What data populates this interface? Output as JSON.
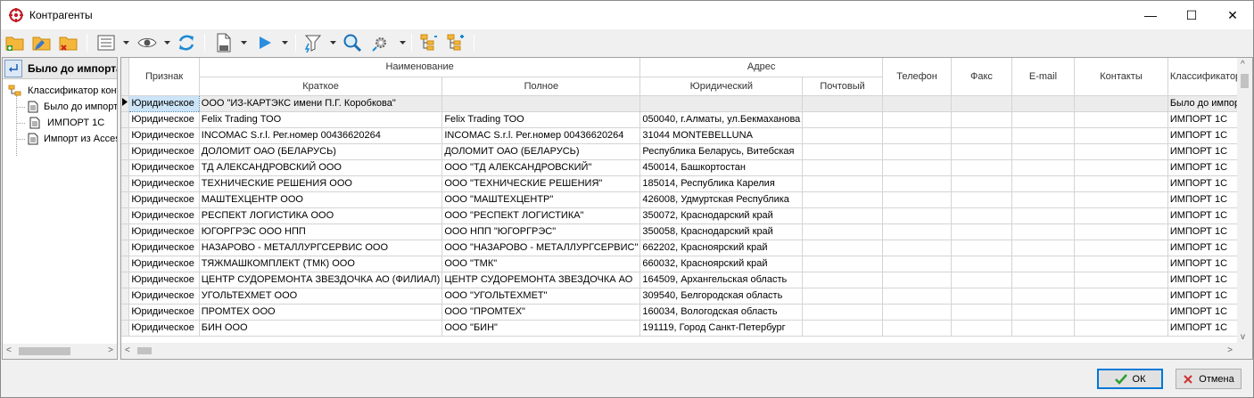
{
  "window": {
    "title": "Контрагенты",
    "minimize_glyph": "—",
    "maximize_glyph": "☐",
    "close_glyph": "✕"
  },
  "toolbar": {
    "icons": [
      "folder-add-icon",
      "folder-edit-icon",
      "folder-delete-icon",
      "list-view-icon",
      "eye-icon",
      "refresh-icon",
      "document-icon",
      "play-icon",
      "filter-icon",
      "search-icon",
      "settings-icon",
      "tree-collapse-icon",
      "tree-expand-icon"
    ]
  },
  "left_pane": {
    "header": "Было до импорта",
    "tree": {
      "root": "Классификатор контрагентов",
      "children": [
        "Было до импорта",
        "ИМПОРТ 1С",
        "Импорт из Access"
      ]
    }
  },
  "grid": {
    "headers": {
      "priznak": "Признак",
      "naimenovanie": "Наименование",
      "kratkoe": "Краткое",
      "polnoe": "Полное",
      "adres": "Адрес",
      "yuridicheskiy": "Юридический",
      "pochtovyy": "Почтовый",
      "telefon": "Телефон",
      "faks": "Факс",
      "email": "E-mail",
      "kontakty": "Контакты",
      "klass": "Классификатор"
    },
    "rows": [
      {
        "priznak": "Юридическое",
        "kratkoe": "ООО \"ИЗ-КАРТЭКС имени П.Г. Коробкова\"",
        "polnoe": "",
        "yur": "",
        "post": "",
        "klass": "Было до импорта"
      },
      {
        "priznak": "Юридическое",
        "kratkoe": "Felix Trading ТОО",
        "polnoe": "Felix Trading ТОО",
        "yur": "050040, г.Алматы, ул.Бекмаханова",
        "post": "",
        "klass": "ИМПОРТ 1С"
      },
      {
        "priznak": "Юридическое",
        "kratkoe": "INCOMAC S.r.l. Рег.номер 00436620264",
        "polnoe": "INCOMAC S.r.l. Рег.номер 00436620264",
        "yur": "31044 MONTEBELLUNA",
        "post": "",
        "klass": "ИМПОРТ 1С"
      },
      {
        "priznak": "Юридическое",
        "kratkoe": "ДОЛОМИТ ОАО (БЕЛАРУСЬ)",
        "polnoe": "ДОЛОМИТ ОАО (БЕЛАРУСЬ)",
        "yur": "Республика Беларусь, Витебская",
        "post": "",
        "klass": "ИМПОРТ 1С"
      },
      {
        "priznak": "Юридическое",
        "kratkoe": "ТД АЛЕКСАНДРОВСКИЙ ООО",
        "polnoe": "ООО \"ТД АЛЕКСАНДРОВСКИЙ\"",
        "yur": "450014, Башкортостан",
        "post": "",
        "klass": "ИМПОРТ 1С"
      },
      {
        "priznak": "Юридическое",
        "kratkoe": "ТЕХНИЧЕСКИЕ РЕШЕНИЯ ООО",
        "polnoe": "ООО \"ТЕХНИЧЕСКИЕ РЕШЕНИЯ\"",
        "yur": "185014, Республика Карелия",
        "post": "",
        "klass": "ИМПОРТ 1С"
      },
      {
        "priznak": "Юридическое",
        "kratkoe": "МАШТЕХЦЕНТР ООО",
        "polnoe": "ООО \"МАШТЕХЦЕНТР\"",
        "yur": "426008, Удмуртская Республика",
        "post": "",
        "klass": "ИМПОРТ 1С"
      },
      {
        "priznak": "Юридическое",
        "kratkoe": "РЕСПЕКТ ЛОГИСТИКА ООО",
        "polnoe": "ООО \"РЕСПЕКТ ЛОГИСТИКА\"",
        "yur": "350072, Краснодарский край",
        "post": "",
        "klass": "ИМПОРТ 1С"
      },
      {
        "priznak": "Юридическое",
        "kratkoe": "ЮГОРГРЭС ООО НПП",
        "polnoe": "ООО НПП \"ЮГОРГРЭС\"",
        "yur": "350058, Краснодарский край",
        "post": "",
        "klass": "ИМПОРТ 1С"
      },
      {
        "priznak": "Юридическое",
        "kratkoe": "НАЗАРОВО - МЕТАЛЛУРГСЕРВИС ООО",
        "polnoe": "ООО \"НАЗАРОВО - МЕТАЛЛУРГСЕРВИС\"",
        "yur": "662202, Красноярский край",
        "post": "",
        "klass": "ИМПОРТ 1С"
      },
      {
        "priznak": "Юридическое",
        "kratkoe": "ТЯЖМАШКОМПЛЕКТ (ТМК) ООО",
        "polnoe": "ООО \"ТМК\"",
        "yur": "660032, Красноярский край",
        "post": "",
        "klass": "ИМПОРТ 1С"
      },
      {
        "priznak": "Юридическое",
        "kratkoe": "ЦЕНТР СУДОРЕМОНТА ЗВЕЗДОЧКА АО (ФИЛИАЛ)",
        "polnoe": "ЦЕНТР СУДОРЕМОНТА ЗВЕЗДОЧКА АО",
        "yur": "164509, Архангельская область",
        "post": "",
        "klass": "ИМПОРТ 1С"
      },
      {
        "priznak": "Юридическое",
        "kratkoe": "УГОЛЬТЕХМЕТ ООО",
        "polnoe": "ООО \"УГОЛЬТЕХМЕТ\"",
        "yur": "309540, Белгородская область",
        "post": "",
        "klass": "ИМПОРТ 1С"
      },
      {
        "priznak": "Юридическое",
        "kratkoe": "ПРОМТЕХ ООО",
        "polnoe": "ООО \"ПРОМТЕХ\"",
        "yur": "160034, Вологодская область",
        "post": "",
        "klass": "ИМПОРТ 1С"
      },
      {
        "priznak": "Юридическое",
        "kratkoe": "БИН ООО",
        "polnoe": "ООО \"БИН\"",
        "yur": "191119, Город Санкт-Петербург",
        "post": "",
        "klass": "ИМПОРТ 1С"
      }
    ]
  },
  "buttons": {
    "ok": "ОК",
    "cancel": "Отмена"
  },
  "colors": {
    "selection": "#cce4f7",
    "accent": "#0078d7",
    "ok_check": "#2e9e2e",
    "cancel_x": "#d03030"
  }
}
